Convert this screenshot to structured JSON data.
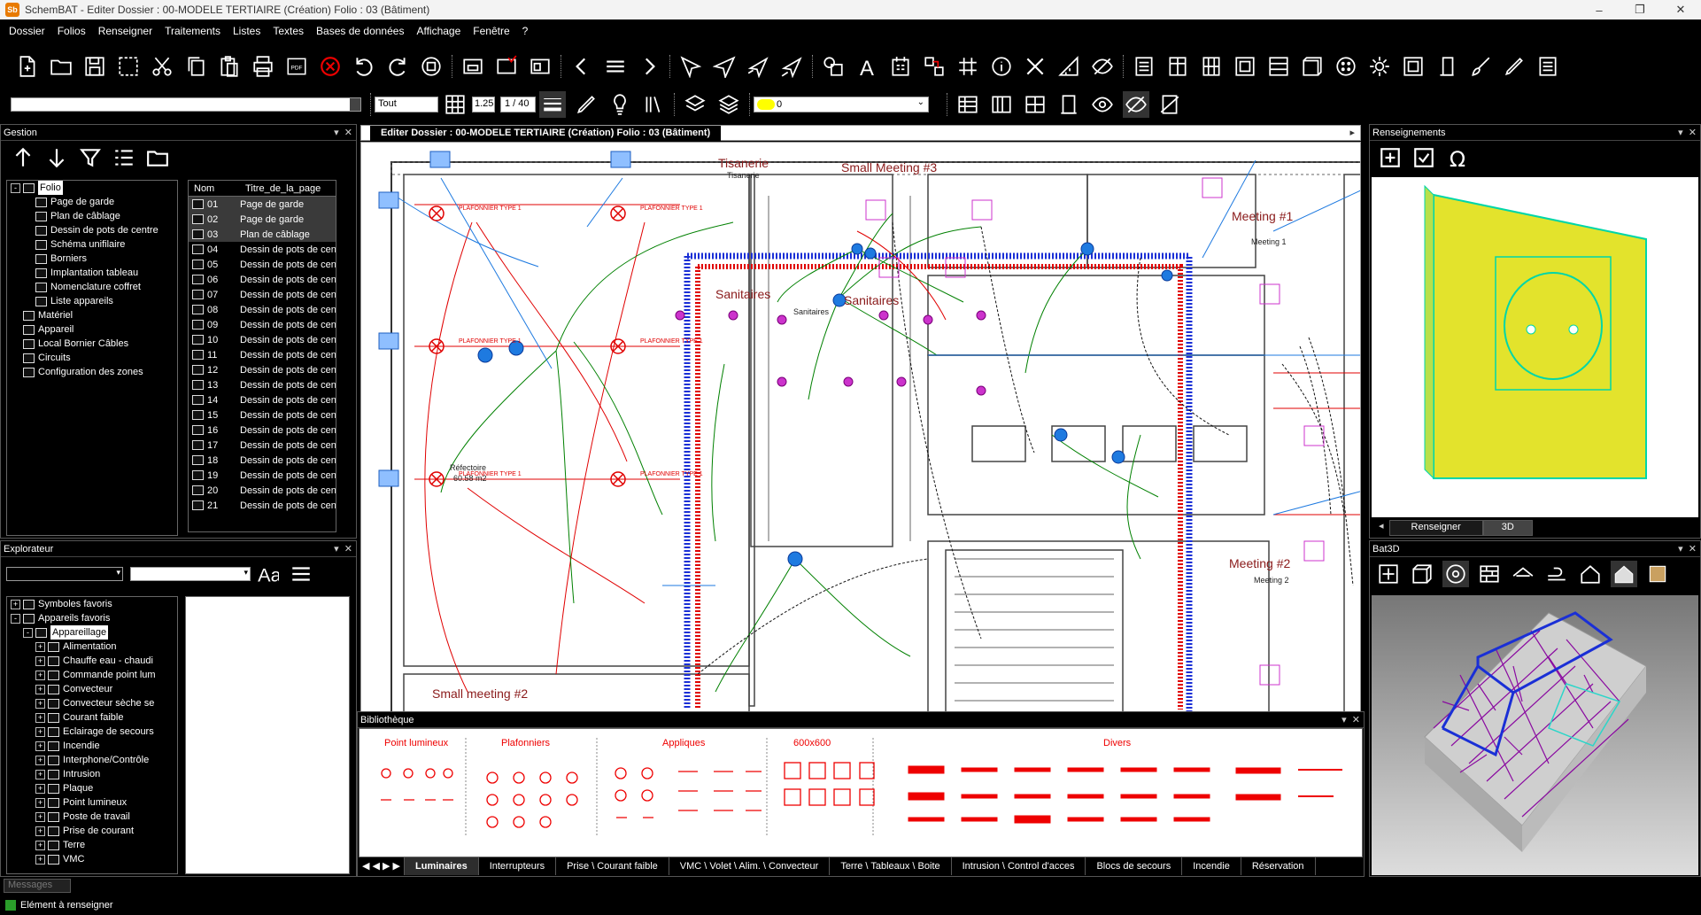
{
  "window": {
    "title": "SchemBAT - Editer  Dossier : 00-MODELE TERTIAIRE  (Création)  Folio : 03  (Bâtiment)",
    "logo": "Sb"
  },
  "menu": [
    "Dossier",
    "Folios",
    "Renseigner",
    "Traitements",
    "Listes",
    "Textes",
    "Bases de données",
    "Affichage",
    "Fenêtre",
    "?"
  ],
  "toolbar2": {
    "layer_select": "Tout",
    "scale": "1.25",
    "ratio": "1 / 40",
    "lamp_select": "0"
  },
  "gestion": {
    "title": "Gestion",
    "tree": [
      {
        "label": "Folio",
        "level": 0,
        "expand": "-",
        "selected": true
      },
      {
        "label": "Page de garde",
        "level": 1
      },
      {
        "label": "Plan de câblage",
        "level": 1
      },
      {
        "label": "Dessin de pots de centre",
        "level": 1
      },
      {
        "label": "Schéma unifilaire",
        "level": 1
      },
      {
        "label": "Borniers",
        "level": 1
      },
      {
        "label": "Implantation tableau",
        "level": 1
      },
      {
        "label": "Nomenclature coffret",
        "level": 1
      },
      {
        "label": "Liste appareils",
        "level": 1
      },
      {
        "label": "Matériel",
        "level": 0
      },
      {
        "label": "Appareil",
        "level": 0
      },
      {
        "label": "Local Bornier Câbles",
        "level": 0
      },
      {
        "label": "Circuits",
        "level": 0
      },
      {
        "label": "Configuration des zones",
        "level": 0
      }
    ],
    "table": {
      "headers": [
        "Nom",
        "Titre_de_la_page"
      ],
      "rows": [
        [
          "01",
          "Page de garde"
        ],
        [
          "02",
          "Page de garde"
        ],
        [
          "03",
          "Plan de câblage"
        ],
        [
          "04",
          "Dessin de pots de cent"
        ],
        [
          "05",
          "Dessin de pots de cent"
        ],
        [
          "06",
          "Dessin de pots de cent"
        ],
        [
          "07",
          "Dessin de pots de cent"
        ],
        [
          "08",
          "Dessin de pots de cent"
        ],
        [
          "09",
          "Dessin de pots de cent"
        ],
        [
          "10",
          "Dessin de pots de cent"
        ],
        [
          "11",
          "Dessin de pots de cent"
        ],
        [
          "12",
          "Dessin de pots de cent"
        ],
        [
          "13",
          "Dessin de pots de cent"
        ],
        [
          "14",
          "Dessin de pots de cent"
        ],
        [
          "15",
          "Dessin de pots de cent"
        ],
        [
          "16",
          "Dessin de pots de cent"
        ],
        [
          "17",
          "Dessin de pots de cent"
        ],
        [
          "18",
          "Dessin de pots de cent"
        ],
        [
          "19",
          "Dessin de pots de cent"
        ],
        [
          "20",
          "Dessin de pots de cent"
        ],
        [
          "21",
          "Dessin de pots de cent"
        ]
      ]
    }
  },
  "explorateur": {
    "title": "Explorateur",
    "tree": [
      {
        "label": "Symboles favoris",
        "level": 0,
        "expand": "+"
      },
      {
        "label": "Appareils favoris",
        "level": 0,
        "expand": "-"
      },
      {
        "label": "Appareillage",
        "level": 1,
        "expand": "-",
        "selected": true
      },
      {
        "label": "Alimentation",
        "level": 2,
        "expand": "+"
      },
      {
        "label": "Chauffe eau - chaudi",
        "level": 2,
        "expand": "+"
      },
      {
        "label": "Commande point lum",
        "level": 2,
        "expand": "+"
      },
      {
        "label": "Convecteur",
        "level": 2,
        "expand": "+"
      },
      {
        "label": "Convecteur sèche se",
        "level": 2,
        "expand": "+"
      },
      {
        "label": "Courant faible",
        "level": 2,
        "expand": "+"
      },
      {
        "label": "Eclairage de secours",
        "level": 2,
        "expand": "+"
      },
      {
        "label": "Incendie",
        "level": 2,
        "expand": "+"
      },
      {
        "label": "Interphone/Contrôle",
        "level": 2,
        "expand": "+"
      },
      {
        "label": "Intrusion",
        "level": 2,
        "expand": "+"
      },
      {
        "label": "Plaque",
        "level": 2,
        "expand": "+"
      },
      {
        "label": "Point lumineux",
        "level": 2,
        "expand": "+"
      },
      {
        "label": "Poste de travail",
        "level": 2,
        "expand": "+"
      },
      {
        "label": "Prise de courant",
        "level": 2,
        "expand": "+"
      },
      {
        "label": "Terre",
        "level": 2,
        "expand": "+"
      },
      {
        "label": "VMC",
        "level": 2,
        "expand": "+"
      }
    ]
  },
  "drawing": {
    "tab": "Editer  Dossier : 00-MODELE TERTIAIRE  (Création)  Folio : 03  (Bâtiment)",
    "rooms": [
      "Tisanerie",
      "Small Meeting #3",
      "Meeting #1",
      "Sanitaires",
      "Sanitaires",
      "Meeting #2",
      "Small meeting #2"
    ],
    "small": [
      "Réfectoire",
      "60.58 m2",
      "Meeting 1",
      "Meeting 2",
      "Sanitaires",
      "Tisanerie"
    ],
    "labels": [
      "PLAFONNIER TYPE 1",
      "PLAFONNIER TYPE 1",
      "PLAFONNIER TYPE 1",
      "PLAFONNIER TYPE 1",
      "PLAFONNIER TYPE 1",
      "PLAFONNIER TYPE 1"
    ]
  },
  "renseignements": {
    "title": "Renseignements",
    "tabs": [
      "Renseigner",
      "3D"
    ],
    "active_tab": "3D"
  },
  "bat3d": {
    "title": "Bat3D"
  },
  "bibliotheque": {
    "title": "Bibliothèque",
    "groups": [
      "Point lumineux",
      "Plafonniers",
      "Appliques",
      "600x600",
      "Divers"
    ],
    "tabs": [
      "Luminaires",
      "Interrupteurs",
      "Prise \\ Courant faible",
      "VMC \\ Volet \\ Alim. \\ Convecteur",
      "Terre \\ Tableaux \\ Boite",
      "Intrusion \\ Control d'acces",
      "Blocs de secours",
      "Incendie",
      "Réservation"
    ],
    "active_tab": "Luminaires"
  },
  "status": {
    "messages_placeholder": "Messages",
    "text": "Elément à renseigner"
  },
  "colors": {
    "wall": "#333333",
    "power": "#e00000",
    "lighting": "#008000",
    "comm": "#1e7ae0",
    "trunk_blue": "#1a2fd6",
    "trunk_red": "#e00000",
    "accent_box": "#cc33cc",
    "model_face": "#e3e32c",
    "model_edge": "#00d6a8",
    "bat3d_line": "#8a0aa0"
  }
}
